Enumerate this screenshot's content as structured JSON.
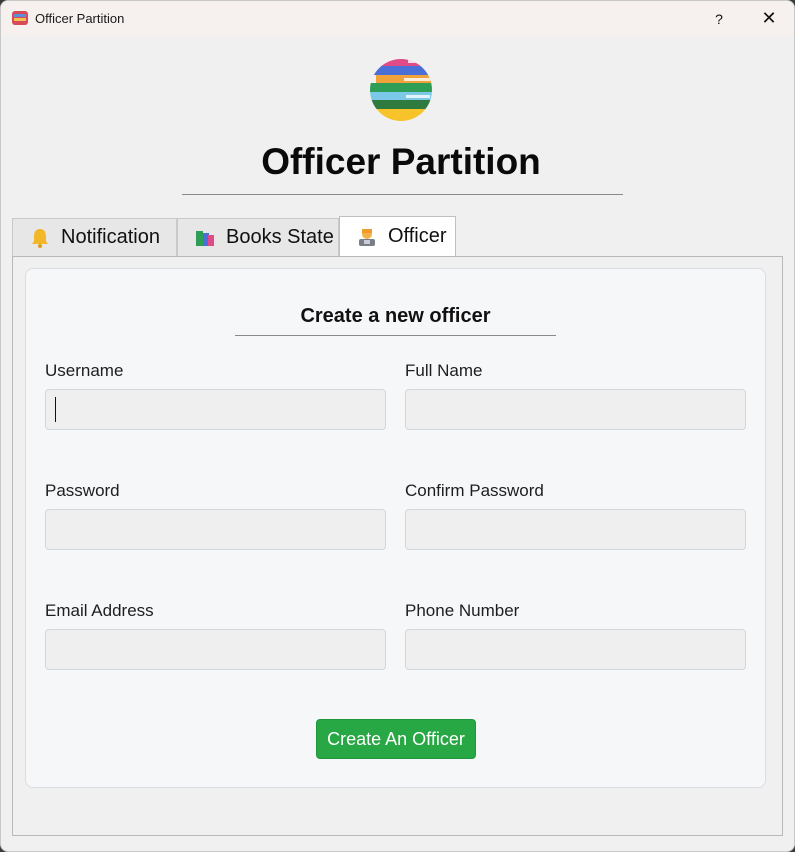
{
  "window": {
    "title": "Officer Partition",
    "help_label": "?",
    "close_label": "✕"
  },
  "header": {
    "title": "Officer Partition",
    "logo_icon": "books-stack-icon"
  },
  "tabs": [
    {
      "label": "Notification",
      "icon": "bell-icon",
      "active": false
    },
    {
      "label": "Books State",
      "icon": "books-icon",
      "active": false
    },
    {
      "label": "Officer",
      "icon": "officer-icon",
      "active": true
    }
  ],
  "form": {
    "title": "Create a new officer",
    "fields": {
      "username": {
        "label": "Username",
        "value": ""
      },
      "full_name": {
        "label": "Full Name",
        "value": ""
      },
      "password": {
        "label": "Password",
        "value": ""
      },
      "confirm_password": {
        "label": "Confirm Password",
        "value": ""
      },
      "email": {
        "label": "Email Address",
        "value": ""
      },
      "phone": {
        "label": "Phone Number",
        "value": ""
      }
    },
    "submit_label": "Create An Officer"
  },
  "colors": {
    "accent_button": "#28a745",
    "card_background": "#f6f7f9",
    "window_background": "#f0f0f0"
  }
}
